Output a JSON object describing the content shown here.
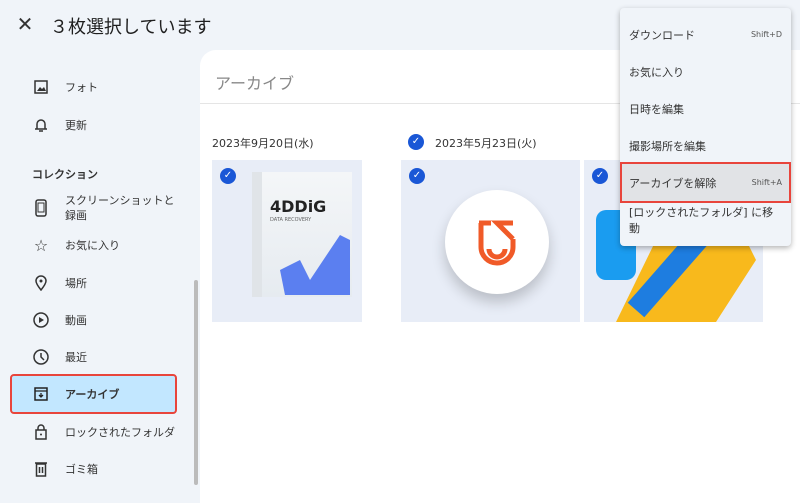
{
  "header": {
    "close_icon": "close-icon",
    "title": "３枚選択しています"
  },
  "sidebar": {
    "items": [
      {
        "label": "フォト",
        "icon": "photo-icon"
      },
      {
        "label": "更新",
        "icon": "bell-icon"
      }
    ],
    "collection_heading": "コレクション",
    "collection": [
      {
        "label": "スクリーンショットと録画",
        "icon": "phone-icon"
      },
      {
        "label": "お気に入り",
        "icon": "star-icon"
      },
      {
        "label": "場所",
        "icon": "location-icon"
      },
      {
        "label": "動画",
        "icon": "play-icon"
      },
      {
        "label": "最近",
        "icon": "clock-icon"
      },
      {
        "label": "アーカイブ",
        "icon": "archive-icon",
        "active": true
      },
      {
        "label": "ロックされたフォルダ",
        "icon": "lock-icon"
      },
      {
        "label": "ゴミ箱",
        "icon": "trash-icon"
      }
    ]
  },
  "main": {
    "title": "アーカイブ",
    "groups": [
      {
        "date": "2023年9月20日(水)",
        "tiles": [
          {
            "title": "4DDiG",
            "subtitle": "DATA RECOVERY"
          }
        ]
      },
      {
        "date": "2023年5月23日(火)",
        "tiles": [
          {
            "title": ""
          },
          {
            "title": ""
          }
        ]
      }
    ]
  },
  "menu": {
    "items": [
      {
        "label": "ダウンロード",
        "shortcut": "Shift+D"
      },
      {
        "label": "お気に入り",
        "shortcut": ""
      },
      {
        "label": "日時を編集",
        "shortcut": ""
      },
      {
        "label": "撮影場所を編集",
        "shortcut": ""
      },
      {
        "label": "アーカイブを解除",
        "shortcut": "Shift+A",
        "highlight": true
      },
      {
        "label": "[ロックされたフォルダ] に移動",
        "shortcut": ""
      }
    ]
  },
  "colors": {
    "accent": "#1a57d6",
    "highlight": "#e8453c",
    "active_bg": "#c2e7ff"
  }
}
